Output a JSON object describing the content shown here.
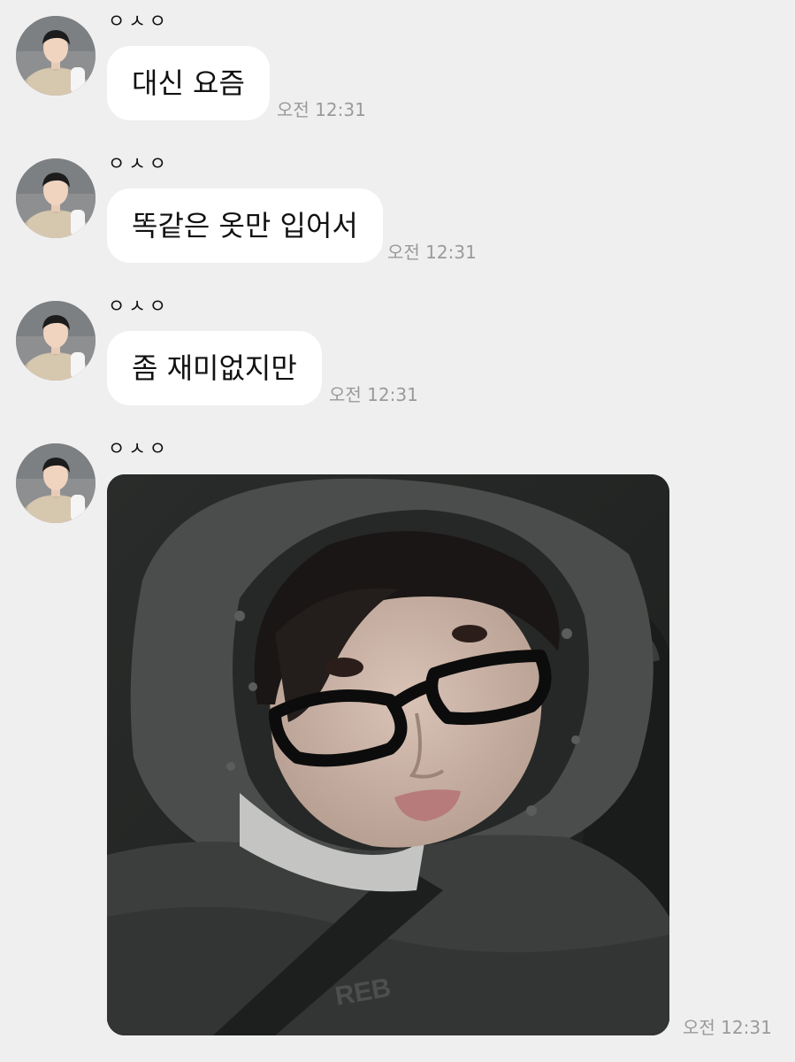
{
  "messages": [
    {
      "sender": "ㅇㅅㅇ",
      "text": "대신 요즘",
      "time": "오전 12:31"
    },
    {
      "sender": "ㅇㅅㅇ",
      "text": "똑같은 옷만 입어서",
      "time": "오전 12:31"
    },
    {
      "sender": "ㅇㅅㅇ",
      "text": "좀 재미없지만",
      "time": "오전 12:31"
    },
    {
      "sender": "ㅇㅅㅇ",
      "type": "photo",
      "time": "오전 12:31"
    }
  ],
  "colors": {
    "background": "#efefef",
    "bubble": "#ffffff",
    "timestamp": "#9a9a9a"
  }
}
